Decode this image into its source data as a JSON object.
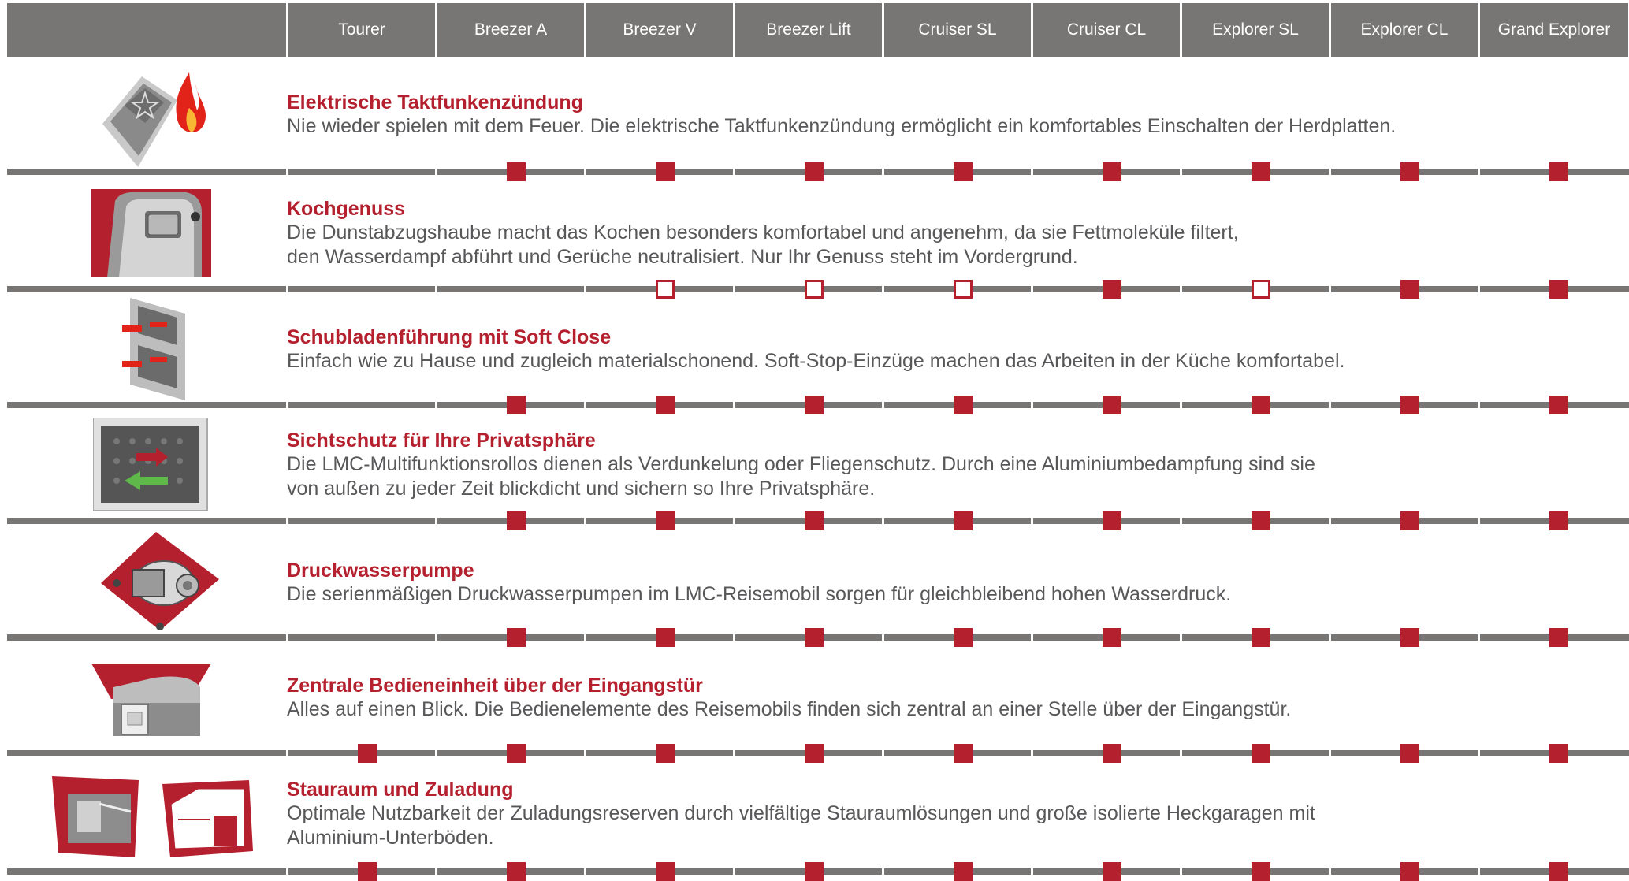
{
  "header": {
    "columns": [
      "Tourer",
      "Breezer A",
      "Breezer V",
      "Breezer Lift",
      "Cruiser SL",
      "Cruiser CL",
      "Explorer SL",
      "Explorer CL",
      "Grand Explorer"
    ]
  },
  "colors": {
    "accent": "#b5202e",
    "header_bg": "#777675",
    "text": "#58585a",
    "line": "#777675"
  },
  "legend_note": "std = filled square, opt = outlined square, none = no marker",
  "features": [
    {
      "title": "Elektrische Taktfunkenzündung",
      "description": "Nie wieder spielen mit dem Feuer. Die elektrische Taktfunkenzündung ermöglicht ein komfortables Einschalten der Herdplatten.",
      "icon": "ignition-switch-flame-icon",
      "availability": [
        "none",
        "std",
        "std",
        "std",
        "std",
        "std",
        "std",
        "std",
        "std"
      ]
    },
    {
      "title": "Kochgenuss",
      "description": "Die Dunstabzugshaube macht das Kochen besonders komfortabel und angenehm, da sie Fettmoleküle filtert,\nden Wasserdampf abführt und Gerüche neutralisiert. Nur Ihr Genuss steht im Vordergrund.",
      "icon": "extractor-hood-icon",
      "availability": [
        "none",
        "none",
        "opt",
        "opt",
        "opt",
        "std",
        "opt",
        "std",
        "std"
      ]
    },
    {
      "title": "Schubladenführung mit Soft Close",
      "description": "Einfach wie zu Hause und zugleich materialschonend. Soft-Stop-Einzüge machen das Arbeiten in der Küche komfortabel.",
      "icon": "drawer-softclose-icon",
      "availability": [
        "none",
        "std",
        "std",
        "std",
        "std",
        "std",
        "std",
        "std",
        "std"
      ]
    },
    {
      "title": "Sichtschutz für Ihre Privatsphäre",
      "description": "Die LMC-Multifunktionsrollos dienen als Verdunkelung oder Fliegenschutz. Durch eine Aluminiumbedampfung sind sie\nvon außen zu jeder Zeit blickdicht und sichern so Ihre Privatsphäre.",
      "icon": "window-blind-icon",
      "availability": [
        "none",
        "std",
        "std",
        "std",
        "std",
        "std",
        "std",
        "std",
        "std"
      ]
    },
    {
      "title": "Druckwasserpumpe",
      "description": "Die serienmäßigen Druckwasserpumpen im LMC-Reisemobil sorgen für gleichbleibend hohen Wasserdruck.",
      "icon": "water-pump-icon",
      "availability": [
        "none",
        "std",
        "std",
        "std",
        "std",
        "std",
        "std",
        "std",
        "std"
      ]
    },
    {
      "title": "Zentrale Bedieneinheit über der Eingangstür",
      "description": "Alles auf einen Blick. Die Bedienelemente des Reisemobils finden sich zentral an einer Stelle über der Eingangstür.",
      "icon": "control-panel-icon",
      "availability": [
        "std",
        "std",
        "std",
        "std",
        "std",
        "std",
        "std",
        "std",
        "std"
      ]
    },
    {
      "title": "Stauraum und Zuladung",
      "description": "Optimale Nutzbarkeit der Zuladungsreserven durch vielfältige Stauraumlösungen und große isolierte Heckgaragen mit\nAluminium-Unterböden.",
      "icon": "storage-garage-icon",
      "availability": [
        "std",
        "std",
        "std",
        "std",
        "std",
        "std",
        "std",
        "std",
        "std"
      ]
    }
  ]
}
